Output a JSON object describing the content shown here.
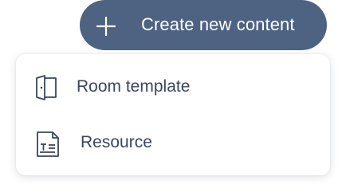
{
  "create_button": {
    "label": "Create new content",
    "icon": "plus-icon",
    "color": "#4e6282"
  },
  "menu": {
    "items": [
      {
        "label": "Room template",
        "icon": "door-icon"
      },
      {
        "label": "Resource",
        "icon": "document-icon"
      }
    ]
  }
}
